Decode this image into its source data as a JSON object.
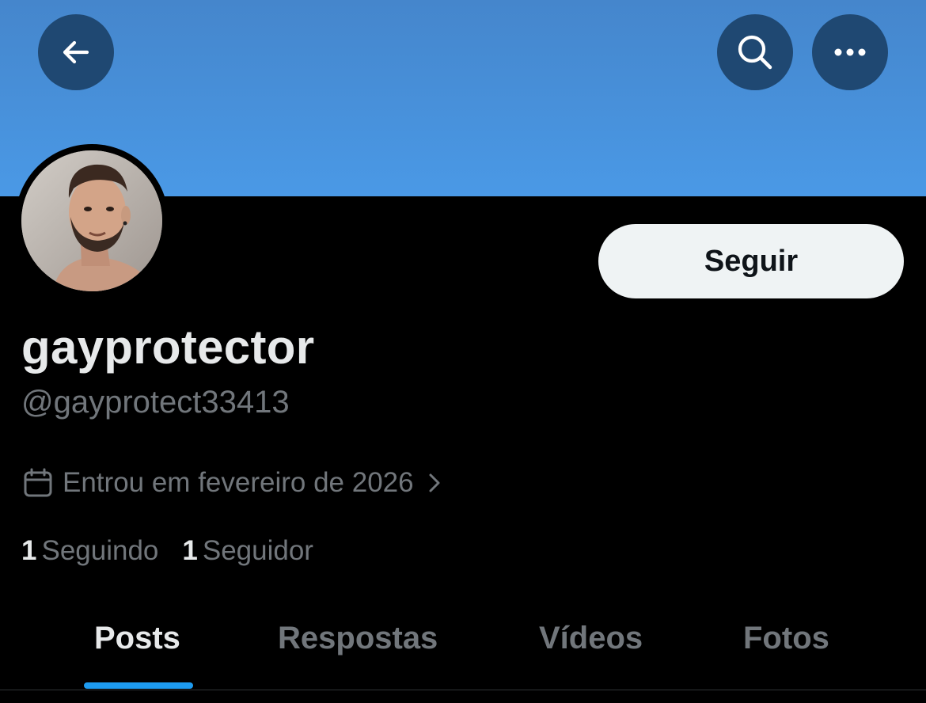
{
  "header": {
    "back_icon": "arrow-left-icon",
    "search_icon": "search-icon",
    "more_icon": "more-horizontal-icon",
    "banner_color": "#4a99e6",
    "button_color": "#1f4872"
  },
  "profile": {
    "display_name": "gayprotector",
    "handle": "@gayprotect33413",
    "follow_label": "Seguir",
    "joined_icon": "calendar-icon",
    "joined_text": "Entrou em fevereiro de 2026",
    "joined_chevron": "chevron-right-icon",
    "following_count": "1",
    "following_label": "Seguindo",
    "followers_count": "1",
    "followers_label": "Seguidor"
  },
  "tabs": [
    {
      "label": "Posts",
      "active": true
    },
    {
      "label": "Respostas",
      "active": false
    },
    {
      "label": "Vídeos",
      "active": false
    },
    {
      "label": "Fotos",
      "active": false
    }
  ],
  "colors": {
    "accent": "#1d9bf0",
    "text_primary": "#e7e9ea",
    "text_secondary": "#71767b",
    "background": "#000000"
  }
}
